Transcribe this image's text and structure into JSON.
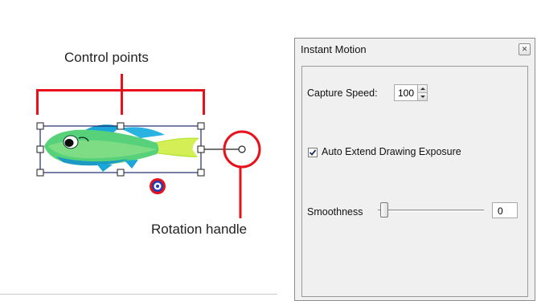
{
  "annotations": {
    "control_points": "Control points",
    "rotation_handle": "Rotation handle"
  },
  "panel": {
    "title": "Instant Motion",
    "close_icon": "close-icon",
    "capture_speed": {
      "label": "Capture Speed:",
      "value": "100"
    },
    "auto_extend": {
      "label": "Auto Extend Drawing Exposure",
      "checked": true
    },
    "smoothness": {
      "label": "Smoothness",
      "value": "0",
      "slider_level": 0
    }
  },
  "colors": {
    "annotation_red": "#e8101a",
    "bounding_box": "#1e2a6e",
    "fish_green": "#57d27a",
    "fish_blue": "#1aa6d8",
    "panel_bg": "#f0f0f0"
  }
}
